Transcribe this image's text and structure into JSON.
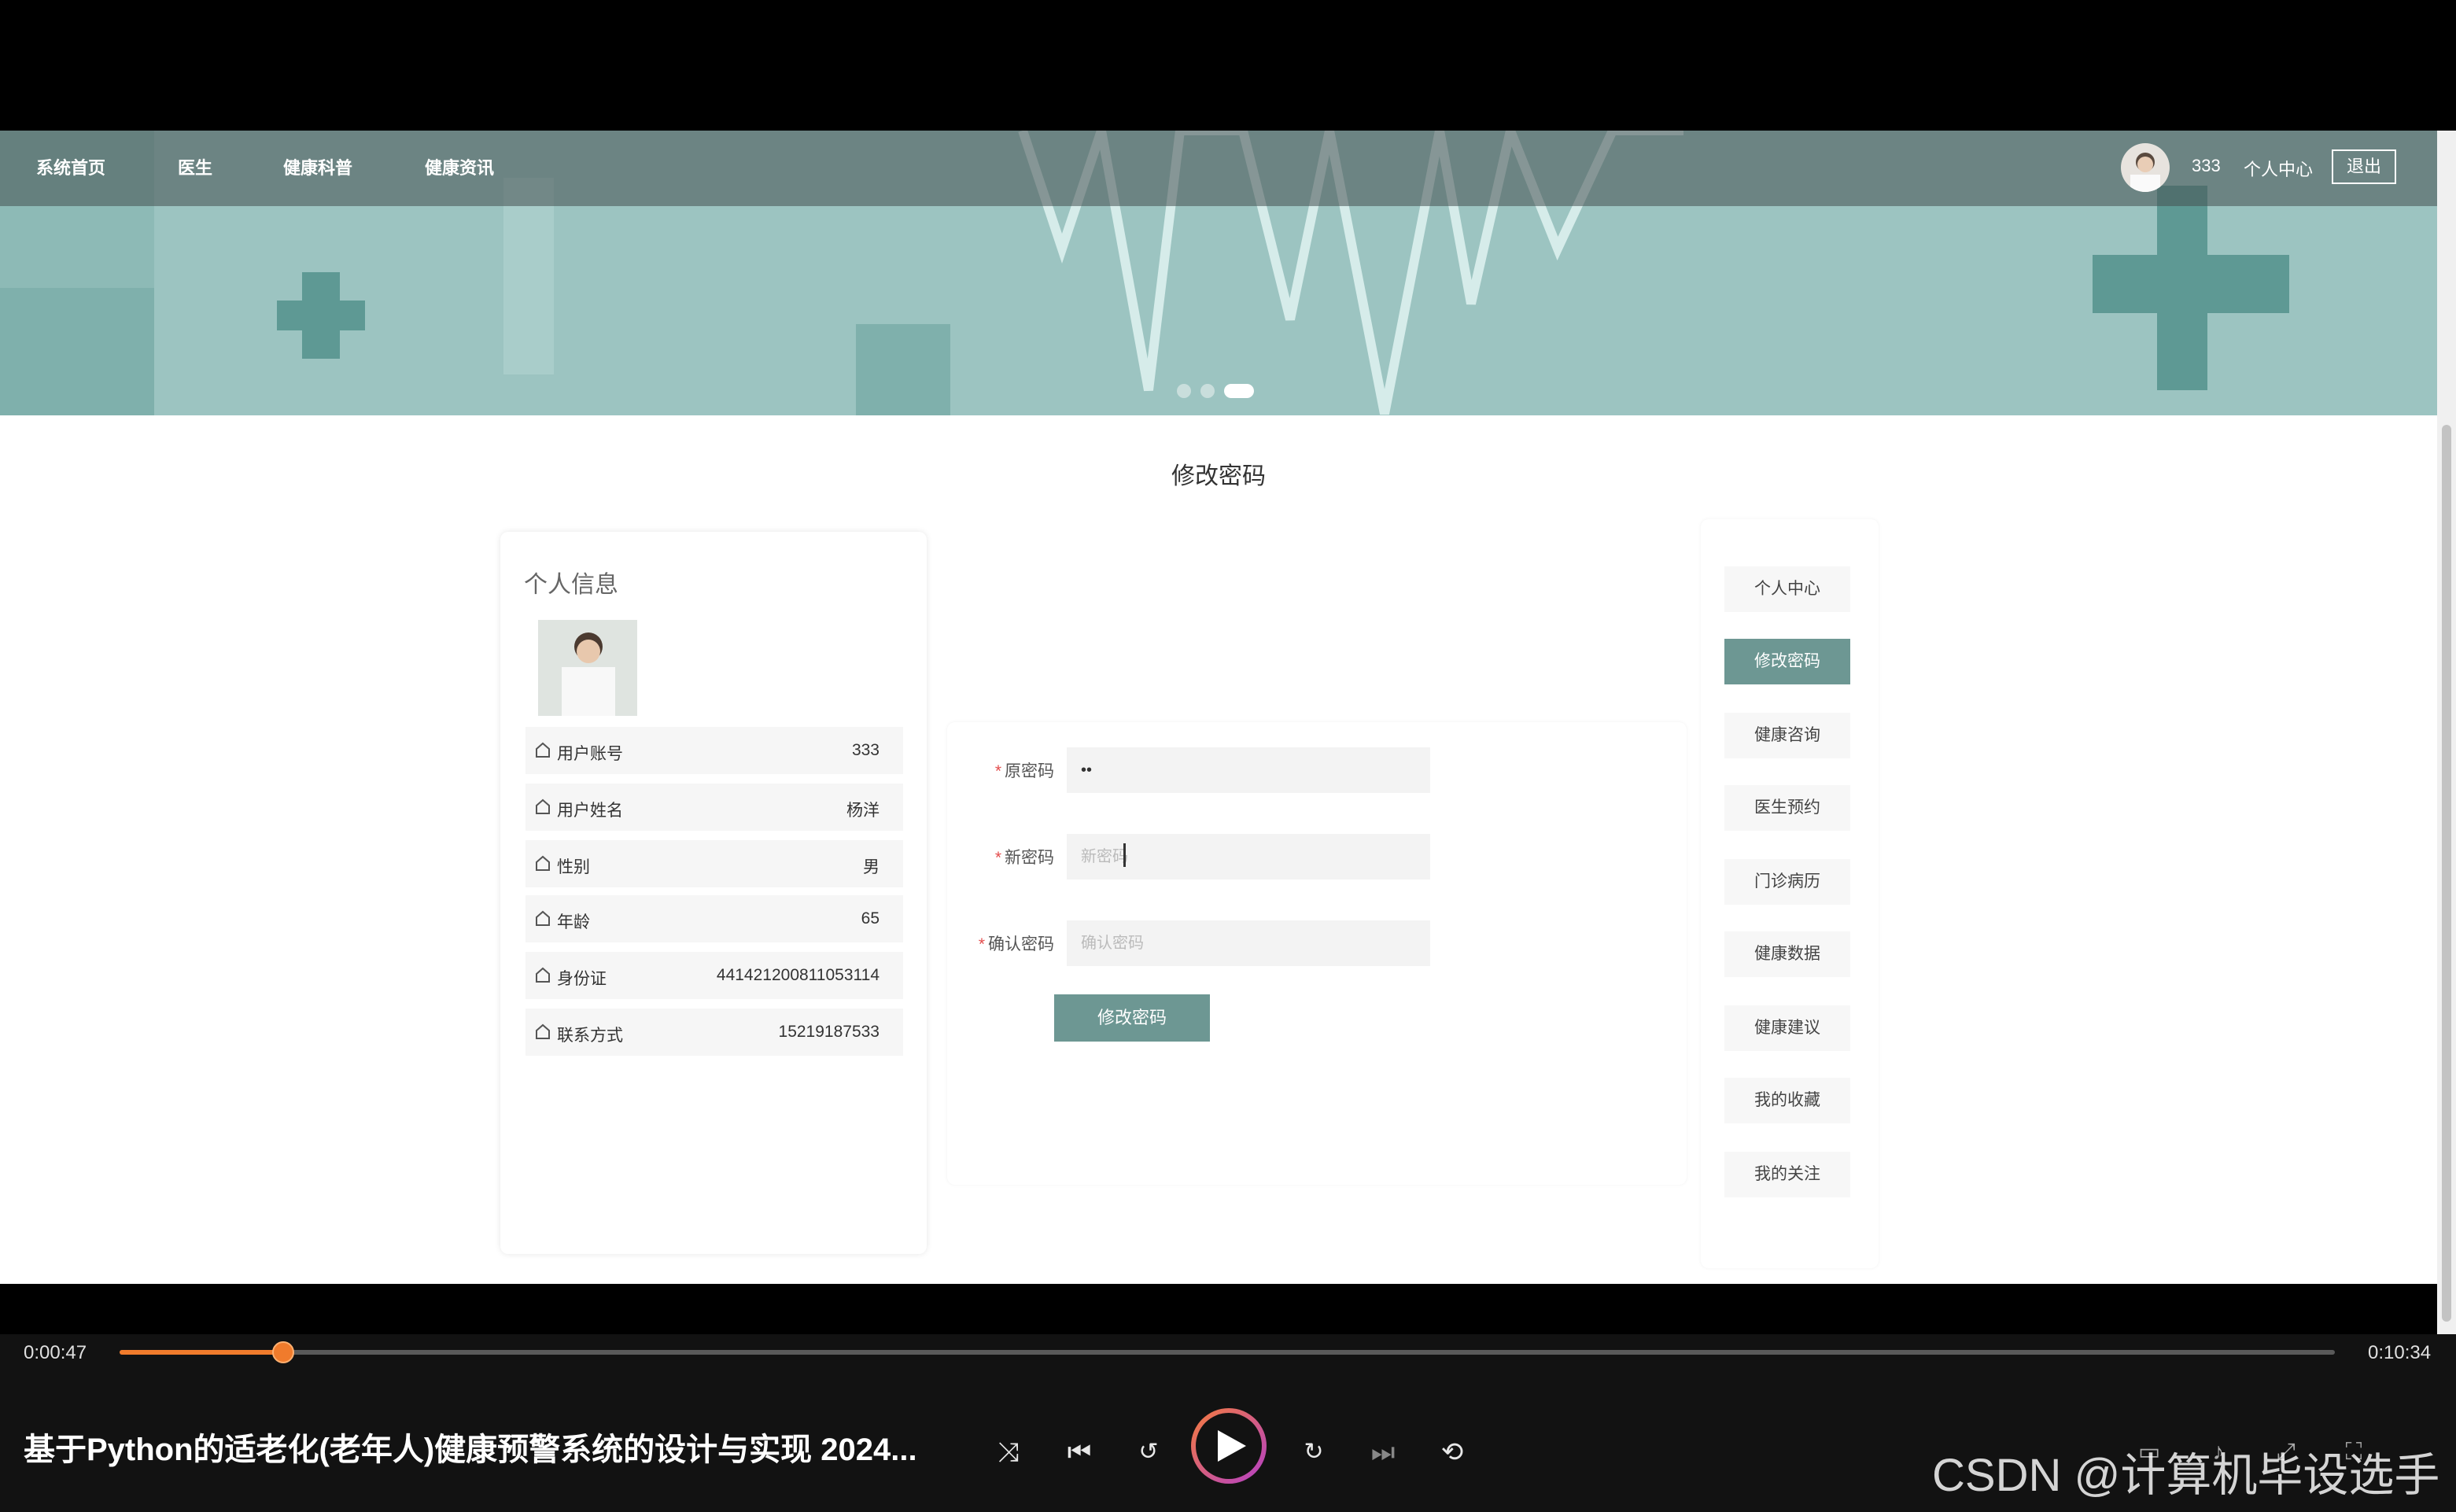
{
  "nav": {
    "items": [
      "系统首页",
      "医生",
      "健康科普",
      "健康资讯"
    ],
    "username": "333",
    "personal_center": "个人中心",
    "logout": "退出"
  },
  "page_title": "修改密码",
  "profile": {
    "title": "个人信息",
    "rows": [
      {
        "label": "用户账号",
        "value": "333"
      },
      {
        "label": "用户姓名",
        "value": "杨洋"
      },
      {
        "label": "性别",
        "value": "男"
      },
      {
        "label": "年龄",
        "value": "65"
      },
      {
        "label": "身份证",
        "value": "441421200811053114"
      },
      {
        "label": "联系方式",
        "value": "15219187533"
      }
    ]
  },
  "form": {
    "old_password": {
      "label": "原密码",
      "value": "••"
    },
    "new_password": {
      "label": "新密码",
      "placeholder": "新密码"
    },
    "confirm_password": {
      "label": "确认密码",
      "placeholder": "确认密码"
    },
    "submit": "修改密码"
  },
  "side_menu": [
    "个人中心",
    "修改密码",
    "健康咨询",
    "医生预约",
    "门诊病历",
    "健康数据",
    "健康建议",
    "我的收藏",
    "我的关注"
  ],
  "side_menu_active": "修改密码",
  "player": {
    "current_time": "0:00:47",
    "total_time": "0:10:34",
    "progress": 0.074,
    "title": "基于Python的适老化(老年人)健康预警系统的设计与实现 2024...",
    "watermark": "CSDN @计算机毕设选手"
  },
  "colors": {
    "accent": "#6d9793",
    "banner": "#9cc4c1",
    "progress": "#f07b2c"
  }
}
